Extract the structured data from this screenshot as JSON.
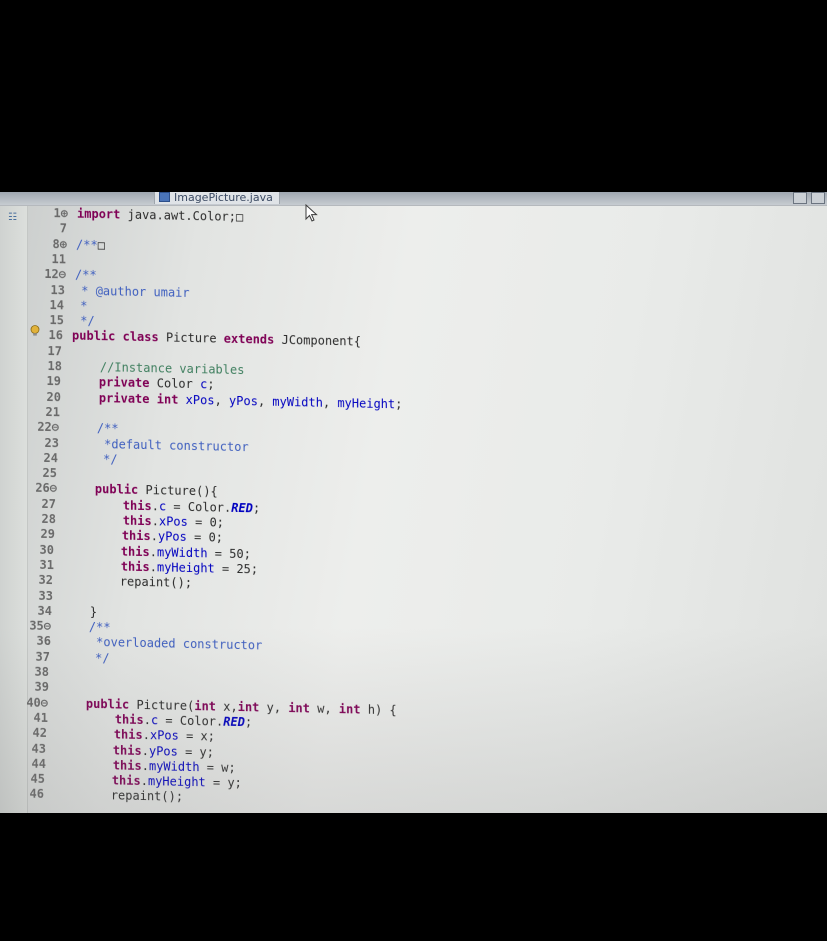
{
  "editor": {
    "tab_title": "ImagePicture.java",
    "tab_icon": "java-file-icon",
    "code_lines": [
      {
        "num": "1⊕",
        "segments": [
          {
            "t": "import",
            "c": "kw"
          },
          {
            "t": " java.awt.Color;",
            "c": ""
          },
          {
            "t": "□",
            "c": ""
          }
        ]
      },
      {
        "num": "7",
        "segments": []
      },
      {
        "num": "8⊕",
        "segments": [
          {
            "t": "/**",
            "c": "jd"
          },
          {
            "t": "□",
            "c": ""
          }
        ]
      },
      {
        "num": "11",
        "segments": []
      },
      {
        "num": "12⊖",
        "segments": [
          {
            "t": "/**",
            "c": "jd"
          }
        ]
      },
      {
        "num": "13",
        "segments": [
          {
            "t": " * @author umair",
            "c": "jd"
          }
        ]
      },
      {
        "num": "14",
        "segments": [
          {
            "t": " *",
            "c": "jd"
          }
        ]
      },
      {
        "num": "15",
        "segments": [
          {
            "t": " */",
            "c": "jd"
          }
        ]
      },
      {
        "num": "16",
        "segments": [
          {
            "t": "public class",
            "c": "kw"
          },
          {
            "t": " Picture ",
            "c": ""
          },
          {
            "t": "extends",
            "c": "kw"
          },
          {
            "t": " JComponent{",
            "c": ""
          }
        ]
      },
      {
        "num": "17",
        "segments": []
      },
      {
        "num": "18",
        "segments": [
          {
            "t": "    //Instance variables",
            "c": "cm"
          }
        ]
      },
      {
        "num": "19",
        "segments": [
          {
            "t": "    ",
            "c": ""
          },
          {
            "t": "private",
            "c": "kw"
          },
          {
            "t": " Color ",
            "c": ""
          },
          {
            "t": "c",
            "c": "fd"
          },
          {
            "t": ";",
            "c": ""
          }
        ]
      },
      {
        "num": "20",
        "segments": [
          {
            "t": "    ",
            "c": ""
          },
          {
            "t": "private int",
            "c": "kw"
          },
          {
            "t": " ",
            "c": ""
          },
          {
            "t": "xPos",
            "c": "fd"
          },
          {
            "t": ", ",
            "c": ""
          },
          {
            "t": "yPos",
            "c": "fd"
          },
          {
            "t": ", ",
            "c": ""
          },
          {
            "t": "myWidth",
            "c": "fd"
          },
          {
            "t": ", ",
            "c": ""
          },
          {
            "t": "myHeight",
            "c": "fd"
          },
          {
            "t": ";",
            "c": ""
          }
        ]
      },
      {
        "num": "21",
        "segments": []
      },
      {
        "num": "22⊖",
        "segments": [
          {
            "t": "    /**",
            "c": "jd"
          }
        ]
      },
      {
        "num": "23",
        "segments": [
          {
            "t": "     *default constructor",
            "c": "jd"
          }
        ]
      },
      {
        "num": "24",
        "segments": [
          {
            "t": "     */",
            "c": "jd"
          }
        ]
      },
      {
        "num": "25",
        "segments": []
      },
      {
        "num": "26⊖",
        "segments": [
          {
            "t": "    ",
            "c": ""
          },
          {
            "t": "public",
            "c": "kw"
          },
          {
            "t": " Picture(){",
            "c": ""
          }
        ]
      },
      {
        "num": "27",
        "segments": [
          {
            "t": "        ",
            "c": ""
          },
          {
            "t": "this",
            "c": "kw"
          },
          {
            "t": ".",
            "c": ""
          },
          {
            "t": "c",
            "c": "fd"
          },
          {
            "t": " = Color.",
            "c": ""
          },
          {
            "t": "RED",
            "c": "it"
          },
          {
            "t": ";",
            "c": ""
          }
        ]
      },
      {
        "num": "28",
        "segments": [
          {
            "t": "        ",
            "c": ""
          },
          {
            "t": "this",
            "c": "kw"
          },
          {
            "t": ".",
            "c": ""
          },
          {
            "t": "xPos",
            "c": "fd"
          },
          {
            "t": " = 0;",
            "c": ""
          }
        ]
      },
      {
        "num": "29",
        "segments": [
          {
            "t": "        ",
            "c": ""
          },
          {
            "t": "this",
            "c": "kw"
          },
          {
            "t": ".",
            "c": ""
          },
          {
            "t": "yPos",
            "c": "fd"
          },
          {
            "t": " = 0;",
            "c": ""
          }
        ]
      },
      {
        "num": "30",
        "segments": [
          {
            "t": "        ",
            "c": ""
          },
          {
            "t": "this",
            "c": "kw"
          },
          {
            "t": ".",
            "c": ""
          },
          {
            "t": "myWidth",
            "c": "fd"
          },
          {
            "t": " = 50;",
            "c": ""
          }
        ]
      },
      {
        "num": "31",
        "segments": [
          {
            "t": "        ",
            "c": ""
          },
          {
            "t": "this",
            "c": "kw"
          },
          {
            "t": ".",
            "c": ""
          },
          {
            "t": "myHeight",
            "c": "fd"
          },
          {
            "t": " = 25;",
            "c": ""
          }
        ]
      },
      {
        "num": "32",
        "segments": [
          {
            "t": "        repaint();",
            "c": ""
          }
        ]
      },
      {
        "num": "33",
        "segments": []
      },
      {
        "num": "34",
        "segments": [
          {
            "t": "    }",
            "c": ""
          }
        ]
      },
      {
        "num": "35⊖",
        "segments": [
          {
            "t": "    /**",
            "c": "jd"
          }
        ]
      },
      {
        "num": "36",
        "segments": [
          {
            "t": "     *overloaded constructor",
            "c": "jd"
          }
        ]
      },
      {
        "num": "37",
        "segments": [
          {
            "t": "     */",
            "c": "jd"
          }
        ]
      },
      {
        "num": "38",
        "segments": []
      },
      {
        "num": "39",
        "segments": []
      },
      {
        "num": "40⊖",
        "segments": [
          {
            "t": "    ",
            "c": ""
          },
          {
            "t": "public",
            "c": "kw"
          },
          {
            "t": " Picture(",
            "c": ""
          },
          {
            "t": "int",
            "c": "kw"
          },
          {
            "t": " x,",
            "c": ""
          },
          {
            "t": "int",
            "c": "kw"
          },
          {
            "t": " y, ",
            "c": ""
          },
          {
            "t": "int",
            "c": "kw"
          },
          {
            "t": " w, ",
            "c": ""
          },
          {
            "t": "int",
            "c": "kw"
          },
          {
            "t": " h) {",
            "c": ""
          }
        ]
      },
      {
        "num": "41",
        "segments": [
          {
            "t": "        ",
            "c": ""
          },
          {
            "t": "this",
            "c": "kw"
          },
          {
            "t": ".",
            "c": ""
          },
          {
            "t": "c",
            "c": "fd"
          },
          {
            "t": " = Color.",
            "c": ""
          },
          {
            "t": "RED",
            "c": "it"
          },
          {
            "t": ";",
            "c": ""
          }
        ]
      },
      {
        "num": "42",
        "segments": [
          {
            "t": "        ",
            "c": ""
          },
          {
            "t": "this",
            "c": "kw"
          },
          {
            "t": ".",
            "c": ""
          },
          {
            "t": "xPos",
            "c": "fd"
          },
          {
            "t": " = x;",
            "c": ""
          }
        ]
      },
      {
        "num": "43",
        "segments": [
          {
            "t": "        ",
            "c": ""
          },
          {
            "t": "this",
            "c": "kw"
          },
          {
            "t": ".",
            "c": ""
          },
          {
            "t": "yPos",
            "c": "fd"
          },
          {
            "t": " = y;",
            "c": ""
          }
        ]
      },
      {
        "num": "44",
        "segments": [
          {
            "t": "        ",
            "c": ""
          },
          {
            "t": "this",
            "c": "kw"
          },
          {
            "t": ".",
            "c": ""
          },
          {
            "t": "myWidth",
            "c": "fd"
          },
          {
            "t": " = w;",
            "c": ""
          }
        ]
      },
      {
        "num": "45",
        "segments": [
          {
            "t": "        ",
            "c": ""
          },
          {
            "t": "this",
            "c": "kw"
          },
          {
            "t": ".",
            "c": ""
          },
          {
            "t": "myHeight",
            "c": "fd"
          },
          {
            "t": " = y;",
            "c": ""
          }
        ]
      },
      {
        "num": "46",
        "segments": [
          {
            "t": "        repaint();",
            "c": ""
          }
        ]
      }
    ]
  },
  "colors": {
    "keyword": "#7f0055",
    "comment": "#3f7f5f",
    "javadoc": "#3f5fbf",
    "field": "#0000c0",
    "background": "#ebedeb"
  }
}
